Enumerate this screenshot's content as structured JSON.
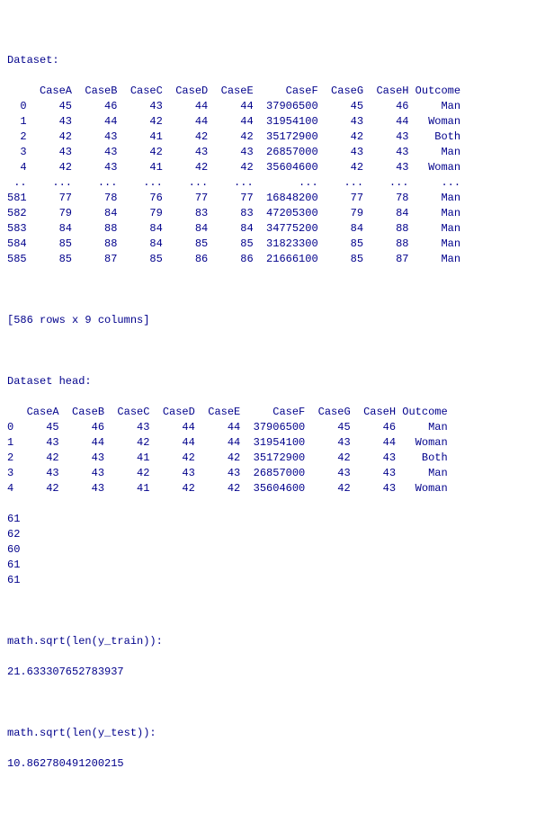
{
  "labels": {
    "dataset_header": "Dataset:",
    "dataset_head_header": "Dataset head:",
    "sqrt_train_label": "math.sqrt(len(y_train)):",
    "sqrt_test_label": "math.sqrt(len(y_test)):",
    "shape_line": "[586 rows x 9 columns]"
  },
  "columns": [
    "CaseA",
    "CaseB",
    "CaseC",
    "CaseD",
    "CaseE",
    "CaseF",
    "CaseG",
    "CaseH",
    "Outcome"
  ],
  "dataset_rows": [
    {
      "idx": "0",
      "CaseA": "45",
      "CaseB": "46",
      "CaseC": "43",
      "CaseD": "44",
      "CaseE": "44",
      "CaseF": "37906500",
      "CaseG": "45",
      "CaseH": "46",
      "Outcome": "Man"
    },
    {
      "idx": "1",
      "CaseA": "43",
      "CaseB": "44",
      "CaseC": "42",
      "CaseD": "44",
      "CaseE": "44",
      "CaseF": "31954100",
      "CaseG": "43",
      "CaseH": "44",
      "Outcome": "Woman"
    },
    {
      "idx": "2",
      "CaseA": "42",
      "CaseB": "43",
      "CaseC": "41",
      "CaseD": "42",
      "CaseE": "42",
      "CaseF": "35172900",
      "CaseG": "42",
      "CaseH": "43",
      "Outcome": "Both"
    },
    {
      "idx": "3",
      "CaseA": "43",
      "CaseB": "43",
      "CaseC": "42",
      "CaseD": "43",
      "CaseE": "43",
      "CaseF": "26857000",
      "CaseG": "43",
      "CaseH": "43",
      "Outcome": "Man"
    },
    {
      "idx": "4",
      "CaseA": "42",
      "CaseB": "43",
      "CaseC": "41",
      "CaseD": "42",
      "CaseE": "42",
      "CaseF": "35604600",
      "CaseG": "42",
      "CaseH": "43",
      "Outcome": "Woman"
    },
    {
      "idx": "..",
      "CaseA": "...",
      "CaseB": "...",
      "CaseC": "...",
      "CaseD": "...",
      "CaseE": "...",
      "CaseF": "...",
      "CaseG": "...",
      "CaseH": "...",
      "Outcome": "..."
    },
    {
      "idx": "581",
      "CaseA": "77",
      "CaseB": "78",
      "CaseC": "76",
      "CaseD": "77",
      "CaseE": "77",
      "CaseF": "16848200",
      "CaseG": "77",
      "CaseH": "78",
      "Outcome": "Man"
    },
    {
      "idx": "582",
      "CaseA": "79",
      "CaseB": "84",
      "CaseC": "79",
      "CaseD": "83",
      "CaseE": "83",
      "CaseF": "47205300",
      "CaseG": "79",
      "CaseH": "84",
      "Outcome": "Man"
    },
    {
      "idx": "583",
      "CaseA": "84",
      "CaseB": "88",
      "CaseC": "84",
      "CaseD": "84",
      "CaseE": "84",
      "CaseF": "34775200",
      "CaseG": "84",
      "CaseH": "88",
      "Outcome": "Man"
    },
    {
      "idx": "584",
      "CaseA": "85",
      "CaseB": "88",
      "CaseC": "84",
      "CaseD": "85",
      "CaseE": "85",
      "CaseF": "31823300",
      "CaseG": "85",
      "CaseH": "88",
      "Outcome": "Man"
    },
    {
      "idx": "585",
      "CaseA": "85",
      "CaseB": "87",
      "CaseC": "85",
      "CaseD": "86",
      "CaseE": "86",
      "CaseF": "21666100",
      "CaseG": "85",
      "CaseH": "87",
      "Outcome": "Man"
    }
  ],
  "head_rows": [
    {
      "idx": "0",
      "CaseA": "45",
      "CaseB": "46",
      "CaseC": "43",
      "CaseD": "44",
      "CaseE": "44",
      "CaseF": "37906500",
      "CaseG": "45",
      "CaseH": "46",
      "Outcome": "Man"
    },
    {
      "idx": "1",
      "CaseA": "43",
      "CaseB": "44",
      "CaseC": "42",
      "CaseD": "44",
      "CaseE": "44",
      "CaseF": "31954100",
      "CaseG": "43",
      "CaseH": "44",
      "Outcome": "Woman"
    },
    {
      "idx": "2",
      "CaseA": "42",
      "CaseB": "43",
      "CaseC": "41",
      "CaseD": "42",
      "CaseE": "42",
      "CaseF": "35172900",
      "CaseG": "42",
      "CaseH": "43",
      "Outcome": "Both"
    },
    {
      "idx": "3",
      "CaseA": "43",
      "CaseB": "43",
      "CaseC": "42",
      "CaseD": "43",
      "CaseE": "43",
      "CaseF": "26857000",
      "CaseG": "43",
      "CaseH": "43",
      "Outcome": "Man"
    },
    {
      "idx": "4",
      "CaseA": "42",
      "CaseB": "43",
      "CaseC": "41",
      "CaseD": "42",
      "CaseE": "42",
      "CaseF": "35604600",
      "CaseG": "42",
      "CaseH": "43",
      "Outcome": "Woman"
    }
  ],
  "extra_indices": [
    "61",
    "62",
    "60",
    "61",
    "61"
  ],
  "sqrt_train_value": "21.633307652783937",
  "sqrt_test_value": "10.862780491200215",
  "widths": {
    "idx": 3,
    "CaseA": 7,
    "CaseB": 7,
    "CaseC": 7,
    "CaseD": 7,
    "CaseE": 7,
    "CaseF": 10,
    "CaseG": 7,
    "CaseH": 7,
    "Outcome": 8
  },
  "head_widths": {
    "idx": 1,
    "CaseA": 7,
    "CaseB": 7,
    "CaseC": 7,
    "CaseD": 7,
    "CaseE": 7,
    "CaseF": 10,
    "CaseG": 7,
    "CaseH": 7,
    "Outcome": 8
  }
}
